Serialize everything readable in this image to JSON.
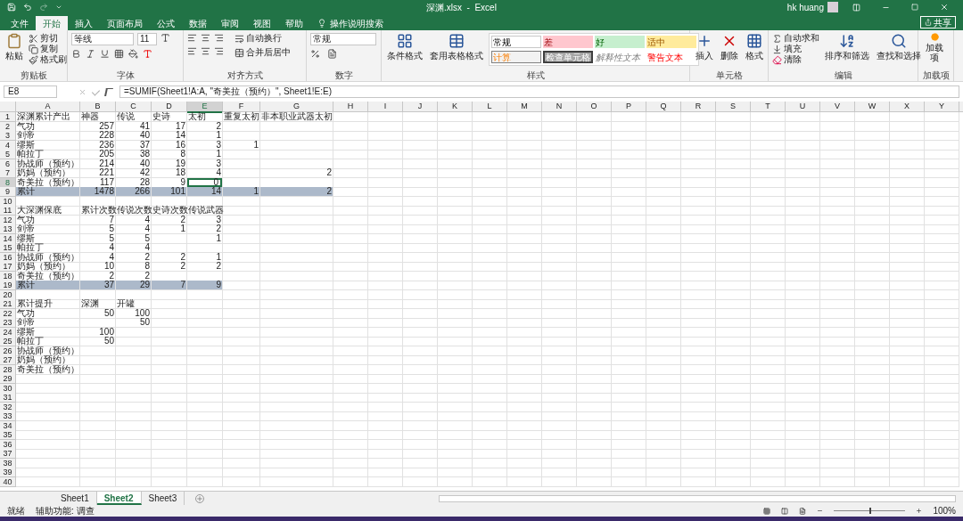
{
  "title_bar": {
    "title": "深渊.xlsx  -  Excel",
    "user": "hk huang"
  },
  "tabs": [
    {
      "label": "文件",
      "selected": false
    },
    {
      "label": "开始",
      "selected": true
    },
    {
      "label": "插入",
      "selected": false
    },
    {
      "label": "页面布局",
      "selected": false
    },
    {
      "label": "公式",
      "selected": false
    },
    {
      "label": "数据",
      "selected": false
    },
    {
      "label": "审阅",
      "selected": false
    },
    {
      "label": "视图",
      "selected": false
    },
    {
      "label": "帮助",
      "selected": false
    }
  ],
  "tell_me": "操作说明搜索",
  "share": "共享",
  "ribbon": {
    "clipboard": {
      "label": "剪贴板",
      "paste": "粘贴",
      "cut": "剪切",
      "copy": "复制",
      "format_painter": "格式刷"
    },
    "font": {
      "label": "字体",
      "family": "等线",
      "size": "11"
    },
    "alignment": {
      "label": "对齐方式",
      "wrap": "自动换行",
      "merge": "合并后居中"
    },
    "number": {
      "label": "数字",
      "format": "常规"
    },
    "styles": {
      "label": "样式",
      "conditional": "条件格式",
      "table": "套用表格格式",
      "gallery": [
        {
          "label": "常规",
          "kind": "normal"
        },
        {
          "label": "差",
          "kind": "bad"
        },
        {
          "label": "好",
          "kind": "good"
        },
        {
          "label": "适中",
          "kind": "neutral"
        },
        {
          "label": "计算",
          "kind": "calc"
        },
        {
          "label": "检查单元格",
          "kind": "check"
        },
        {
          "label": "解释性文本",
          "kind": "explain"
        },
        {
          "label": "警告文本",
          "kind": "warn"
        }
      ]
    },
    "cells": {
      "label": "单元格",
      "insert": "插入",
      "delete": "删除",
      "format": "格式"
    },
    "editing": {
      "label": "编辑",
      "autosum": "自动求和",
      "fill": "填充",
      "clear": "清除",
      "sort": "排序和筛选",
      "find": "查找和选择"
    },
    "addins": {
      "label": "加载项",
      "button": "加载项"
    }
  },
  "formula_bar": {
    "name_box": "E8",
    "formula": "=SUMIF(Sheet1!A:A, \"奇美拉（预约）\", Sheet1!E:E)"
  },
  "sheet": {
    "columns": [
      {
        "label": "A",
        "selected": false
      },
      {
        "label": "B",
        "selected": false
      },
      {
        "label": "C",
        "selected": false
      },
      {
        "label": "D",
        "selected": false
      },
      {
        "label": "E",
        "selected": true
      },
      {
        "label": "F",
        "selected": false
      },
      {
        "label": "G",
        "selected": false
      },
      {
        "label": "H",
        "selected": false
      },
      {
        "label": "I",
        "selected": false
      },
      {
        "label": "J",
        "selected": false
      },
      {
        "label": "K",
        "selected": false
      },
      {
        "label": "L",
        "selected": false
      },
      {
        "label": "M",
        "selected": false
      },
      {
        "label": "N",
        "selected": false
      },
      {
        "label": "O",
        "selected": false
      },
      {
        "label": "P",
        "selected": false
      },
      {
        "label": "Q",
        "selected": false
      },
      {
        "label": "R",
        "selected": false
      },
      {
        "label": "S",
        "selected": false
      },
      {
        "label": "T",
        "selected": false
      },
      {
        "label": "U",
        "selected": false
      },
      {
        "label": "V",
        "selected": false
      },
      {
        "label": "W",
        "selected": false
      },
      {
        "label": "X",
        "selected": false
      },
      {
        "label": "Y",
        "selected": false
      }
    ],
    "rows": [
      {
        "number": "1",
        "kind": "header",
        "selected": false,
        "cells": [
          "深渊累计产出",
          "神器",
          "传说",
          "史诗",
          "太初",
          "重复太初",
          "非本职业武器太初"
        ]
      },
      {
        "number": "2",
        "kind": "data",
        "selected": false,
        "cells": [
          "气功",
          "257",
          "41",
          "17",
          "2"
        ]
      },
      {
        "number": "3",
        "kind": "data",
        "selected": false,
        "cells": [
          "剑帝",
          "228",
          "40",
          "14",
          "1"
        ]
      },
      {
        "number": "4",
        "kind": "data",
        "selected": false,
        "cells": [
          "缪斯",
          "236",
          "37",
          "16",
          "3",
          "1"
        ]
      },
      {
        "number": "5",
        "kind": "data",
        "selected": false,
        "cells": [
          "帕拉丁",
          "205",
          "38",
          "8",
          "1"
        ]
      },
      {
        "number": "6",
        "kind": "data",
        "selected": false,
        "cells": [
          "协战师（预约）",
          "214",
          "40",
          "19",
          "3"
        ]
      },
      {
        "number": "7",
        "kind": "data",
        "selected": false,
        "cells": [
          "奶妈（预约）",
          "221",
          "42",
          "18",
          "4",
          null,
          "2"
        ]
      },
      {
        "number": "8",
        "kind": "data",
        "selected": true,
        "cells": [
          "奇美拉（预约）",
          "117",
          "28",
          "9",
          "0"
        ]
      },
      {
        "number": "9",
        "kind": "total",
        "selected": false,
        "cells": [
          "累计",
          "1478",
          "266",
          "101",
          "14",
          "1",
          "2"
        ]
      },
      {
        "number": "10",
        "kind": "blank",
        "selected": false
      },
      {
        "number": "11",
        "kind": "header",
        "selected": false,
        "cells": [
          "大深渊保底",
          "累计次数",
          "传说次数",
          "史诗次数",
          "传说武器"
        ]
      },
      {
        "number": "12",
        "kind": "data",
        "selected": false,
        "cells": [
          "气功",
          "7",
          "4",
          "2",
          "3"
        ]
      },
      {
        "number": "13",
        "kind": "data",
        "selected": false,
        "cells": [
          "剑帝",
          "5",
          "4",
          "1",
          "2"
        ]
      },
      {
        "number": "14",
        "kind": "data",
        "selected": false,
        "cells": [
          "缪斯",
          "5",
          "5",
          null,
          "1"
        ]
      },
      {
        "number": "15",
        "kind": "data",
        "selected": false,
        "cells": [
          "帕拉丁",
          "4",
          "4"
        ]
      },
      {
        "number": "16",
        "kind": "data",
        "selected": false,
        "cells": [
          "协战师（预约）",
          "4",
          "2",
          "2",
          "1"
        ]
      },
      {
        "number": "17",
        "kind": "data",
        "selected": false,
        "cells": [
          "奶妈（预约）",
          "10",
          "8",
          "2",
          "2"
        ]
      },
      {
        "number": "18",
        "kind": "data",
        "selected": false,
        "cells": [
          "奇美拉（预约）",
          "2",
          "2"
        ]
      },
      {
        "number": "19",
        "kind": "total",
        "selected": false,
        "cells": [
          "累计",
          "37",
          "29",
          "7",
          "9"
        ]
      },
      {
        "number": "20",
        "kind": "blank",
        "selected": false
      },
      {
        "number": "21",
        "kind": "header",
        "selected": false,
        "cells": [
          "累计提升",
          "深渊",
          "开罐"
        ]
      },
      {
        "number": "22",
        "kind": "data",
        "selected": false,
        "cells": [
          "气功",
          "50",
          "100"
        ]
      },
      {
        "number": "23",
        "kind": "data",
        "selected": false,
        "cells": [
          "剑帝",
          null,
          "50"
        ]
      },
      {
        "number": "24",
        "kind": "data",
        "selected": false,
        "cells": [
          "缪斯",
          "100"
        ]
      },
      {
        "number": "25",
        "kind": "data",
        "selected": false,
        "cells": [
          "帕拉丁",
          "50"
        ]
      },
      {
        "number": "26",
        "kind": "data",
        "selected": false,
        "cells": [
          "协战师（预约）"
        ]
      },
      {
        "number": "27",
        "kind": "data",
        "selected": false,
        "cells": [
          "奶妈（预约）"
        ]
      },
      {
        "number": "28",
        "kind": "data",
        "selected": false,
        "cells": [
          "奇美拉（预约）"
        ]
      },
      {
        "number": "29",
        "kind": "blank",
        "selected": false
      },
      {
        "number": "30",
        "kind": "blank",
        "selected": false
      },
      {
        "number": "31",
        "kind": "blank",
        "selected": false
      },
      {
        "number": "32",
        "kind": "blank",
        "selected": false
      },
      {
        "number": "33",
        "kind": "blank",
        "selected": false
      },
      {
        "number": "34",
        "kind": "blank",
        "selected": false
      },
      {
        "number": "35",
        "kind": "blank",
        "selected": false
      },
      {
        "number": "36",
        "kind": "blank",
        "selected": false
      },
      {
        "number": "37",
        "kind": "blank",
        "selected": false
      },
      {
        "number": "38",
        "kind": "blank",
        "selected": false
      },
      {
        "number": "39",
        "kind": "blank",
        "selected": false
      },
      {
        "number": "40",
        "kind": "blank",
        "selected": false
      }
    ]
  },
  "sheet_tabs": [
    {
      "label": "Sheet1",
      "selected": false
    },
    {
      "label": "Sheet2",
      "selected": true
    },
    {
      "label": "Sheet3",
      "selected": false
    }
  ],
  "status_bar": {
    "ready": "就绪",
    "accessibility": "辅助功能: 调查",
    "zoom": "100%",
    "zoom_slider": {
      "level": 0.5
    }
  }
}
